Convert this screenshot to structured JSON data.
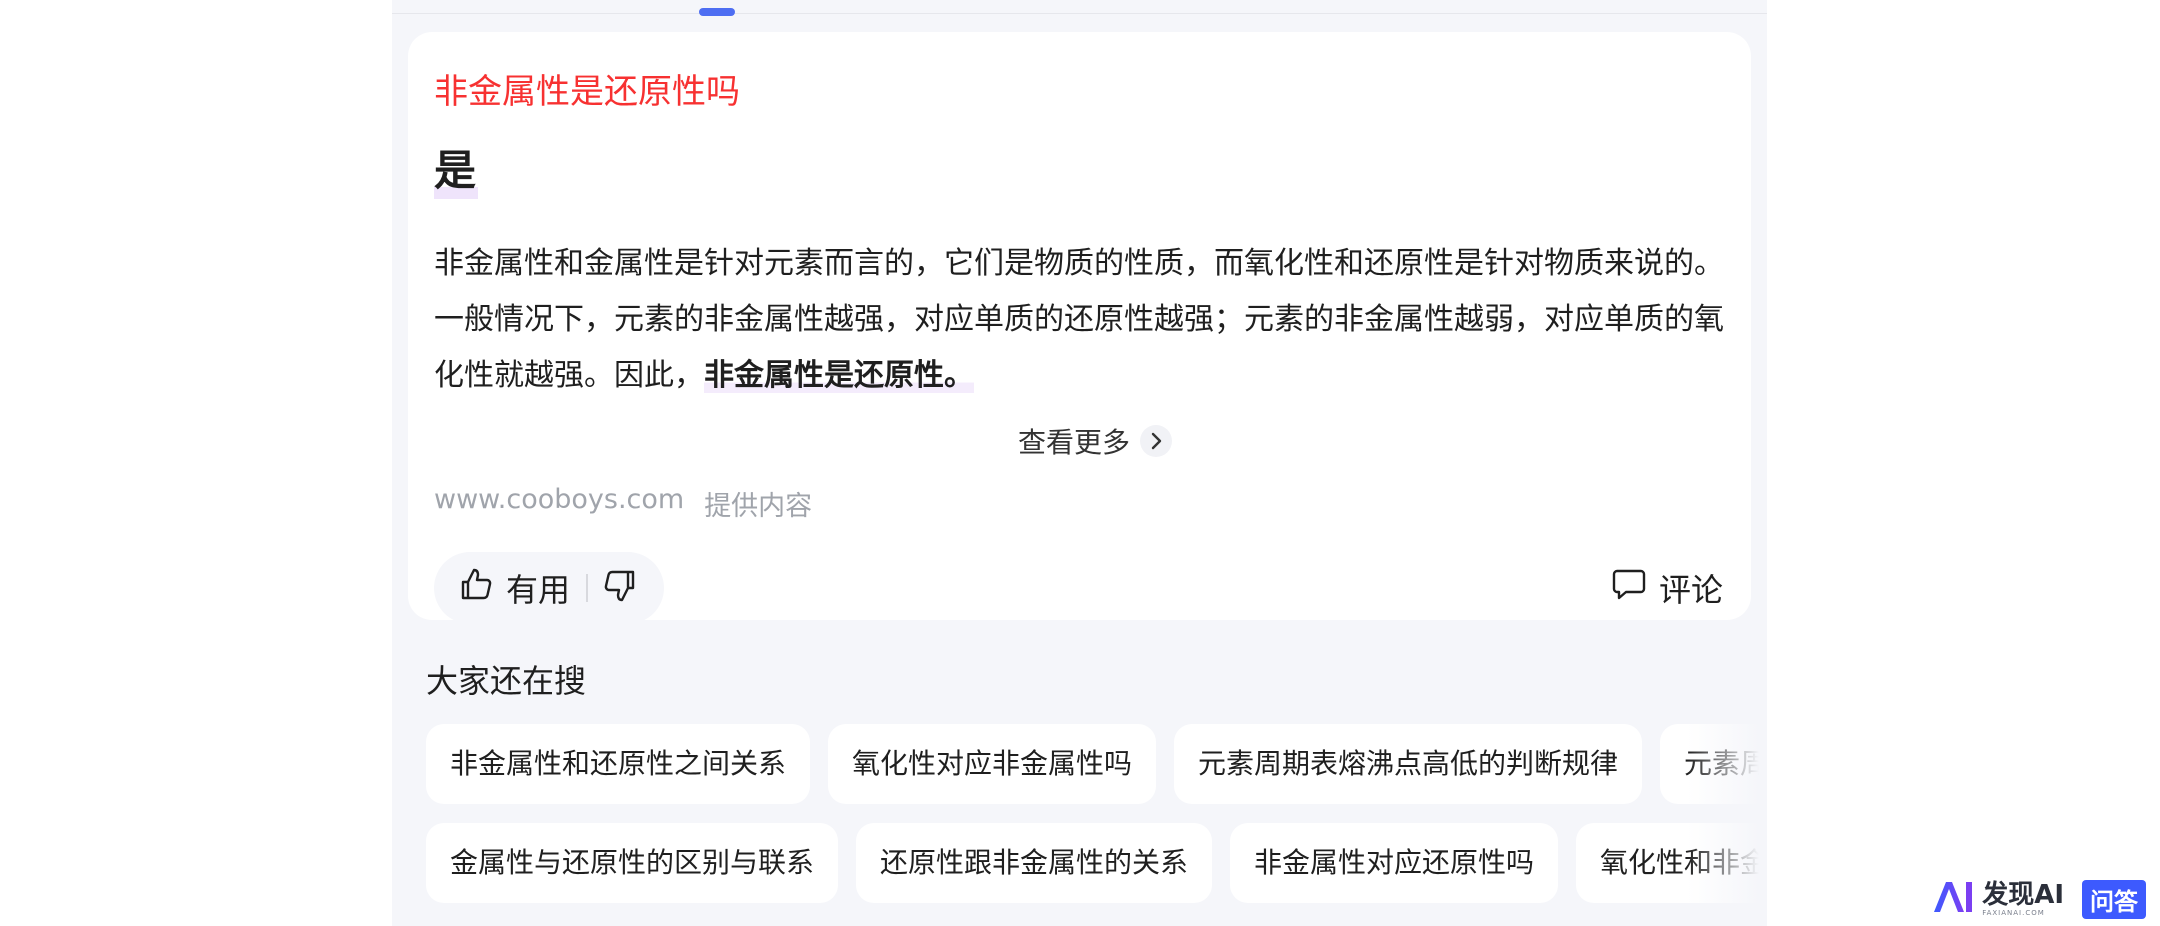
{
  "answer_card": {
    "question": "非金属性是还原性吗",
    "short_answer": "是",
    "body_text": "非金属性和金属性是针对元素而言的，它们是物质的性质，而氧化性和还原性是针对物质来说的。一般情况下，元素的非金属性越强，对应单质的还原性越强；元素的非金属性越弱，对应单质的氧化性就越强。因此，",
    "body_highlight": "非金属性是还原性。",
    "see_more_label": "查看更多",
    "source_site": "www.cooboys.com",
    "source_suffix": "提供内容",
    "useful_label": "有用",
    "comment_label": "评论"
  },
  "related": {
    "title": "大家还在搜",
    "row1": [
      "非金属性和还原性之间关系",
      "氧化性对应非金属性吗",
      "元素周期表熔沸点高低的判断规律",
      "元素周期表"
    ],
    "row2": [
      "金属性与还原性的区别与联系",
      "还原性跟非金属性的关系",
      "非金属性对应还原性吗",
      "氧化性和非金属性"
    ]
  },
  "watermark": {
    "ai_mark": "AI",
    "brand": "发现AI",
    "brand_sub": "FAXIANAI.COM",
    "badge": "问答"
  },
  "colors": {
    "accent": "#4e6ef2",
    "question_red": "#f73131",
    "background": "#f5f6fa"
  },
  "icons": [
    "thumbs-up-icon",
    "thumbs-down-icon",
    "comment-icon",
    "chevron-right-icon"
  ]
}
